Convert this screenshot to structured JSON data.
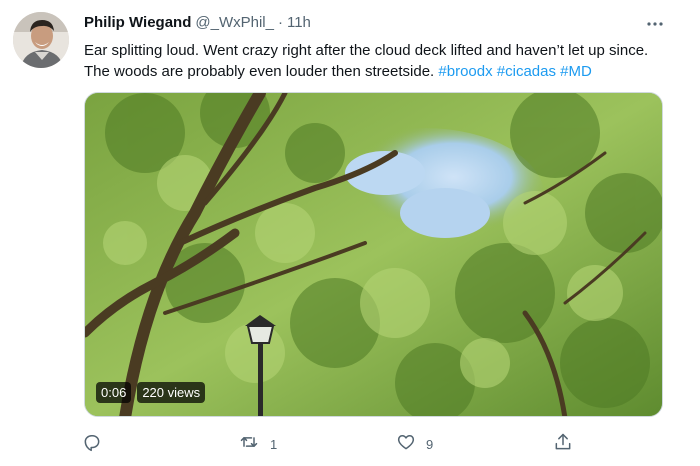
{
  "tweet": {
    "author_name": "Philip Wiegand",
    "handle": "@_WxPhil_",
    "separator": "·",
    "time": "11h",
    "text_plain": "Ear splitting loud. Went crazy right after the cloud deck lifted and haven’t let up since. The woods are probably even louder then streetside. ",
    "hashtags": [
      "#broodx",
      "#cicadas",
      "#MD"
    ],
    "video": {
      "duration": "0:06",
      "views": "220 views"
    },
    "actions": {
      "reply_count": "",
      "retweet_count": "1",
      "like_count": "9"
    },
    "icons": {
      "more": "more-horizontal-icon",
      "reply": "reply-icon",
      "retweet": "retweet-icon",
      "like": "heart-icon",
      "share": "share-icon"
    },
    "colors": {
      "text": "#0f1419",
      "secondary": "#536471",
      "link": "#1d9bf0"
    }
  }
}
